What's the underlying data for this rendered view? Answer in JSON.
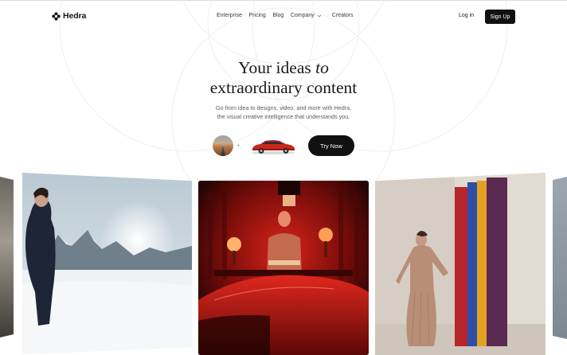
{
  "brand": {
    "name": "Hedra",
    "logo_icon": "flower-icon"
  },
  "nav": {
    "links": [
      "Enterprise",
      "Pricing",
      "Blog",
      "Company",
      "Creators"
    ],
    "company_dropdown_icon": "chevron-down-icon",
    "login_label": "Log in",
    "signup_label": "Sign Up"
  },
  "hero": {
    "title_line1_plain": "Your ideas",
    "title_line1_italic": "to",
    "title_line2": "extraordinary content",
    "subtitle_line1": "Go from idea to designs, video, and more with Hedra,",
    "subtitle_line2": "the visual creative intelligence that understands you."
  },
  "composer": {
    "plus": "+",
    "cta_label": "Try Now"
  },
  "colors": {
    "accent_dark": "#111111",
    "text_primary": "#1a1a1a",
    "text_secondary": "#5c5c5c"
  }
}
